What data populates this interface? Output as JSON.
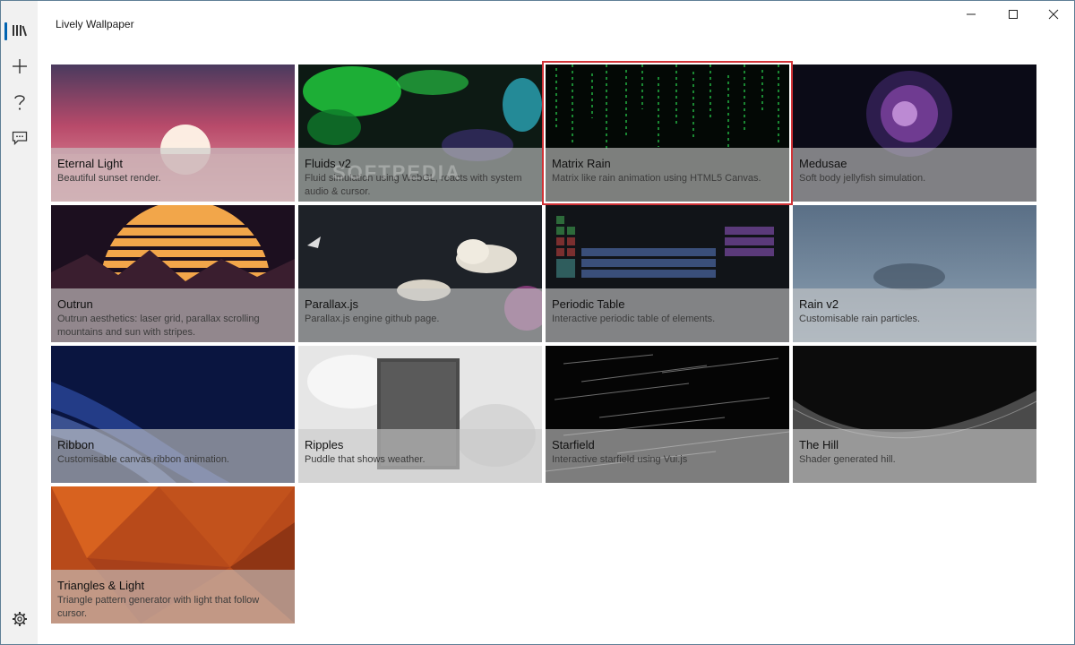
{
  "app": {
    "title": "Lively Wallpaper"
  },
  "rail": {
    "items": [
      {
        "id": "library",
        "icon": "library-icon",
        "selected": true
      },
      {
        "id": "add",
        "icon": "plus-icon"
      },
      {
        "id": "help",
        "icon": "help-icon"
      },
      {
        "id": "feedback",
        "icon": "feedback-icon"
      }
    ],
    "settings_icon": "gear-icon"
  },
  "window_controls": [
    "minimize-icon",
    "maximize-icon",
    "close-icon"
  ],
  "wallpapers": [
    {
      "name": "Eternal Light",
      "desc": "Beautiful sunset render."
    },
    {
      "name": "Fluids v2",
      "desc": "Fluid simulation using WebGL, reacts with system audio & cursor."
    },
    {
      "name": "Matrix Rain",
      "desc": "Matrix like rain animation using HTML5 Canvas.",
      "selected": true
    },
    {
      "name": "Medusae",
      "desc": "Soft body jellyfish simulation."
    },
    {
      "name": "Outrun",
      "desc": "Outrun aesthetics: laser grid, parallax scrolling mountains and sun with stripes."
    },
    {
      "name": "Parallax.js",
      "desc": "Parallax.js engine github page."
    },
    {
      "name": "Periodic Table",
      "desc": "Interactive periodic table of elements."
    },
    {
      "name": "Rain v2",
      "desc": "Customisable rain particles."
    },
    {
      "name": "Ribbon",
      "desc": "Customisable canvas ribbon animation."
    },
    {
      "name": "Ripples",
      "desc": "Puddle that shows weather."
    },
    {
      "name": "Starfield",
      "desc": "Interactive starfield using Vui.js"
    },
    {
      "name": "The Hill",
      "desc": "Shader generated hill."
    },
    {
      "name": "Triangles & Light",
      "desc": "Triangle pattern generator with light that follow cursor."
    }
  ],
  "watermark": "SOFTPEDIA",
  "colors": {
    "accent": "#0063b1",
    "selection": "#d13438"
  }
}
